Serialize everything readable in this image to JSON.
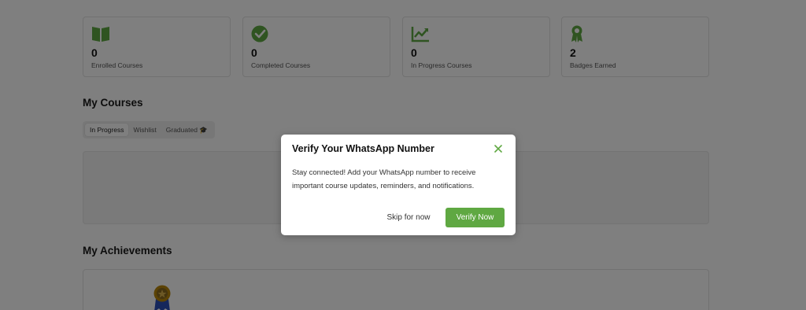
{
  "stats": [
    {
      "value": "0",
      "label": "Enrolled Courses",
      "icon": "book-open-icon"
    },
    {
      "value": "0",
      "label": "Completed Courses",
      "icon": "check-circle-icon"
    },
    {
      "value": "0",
      "label": "In Progress Courses",
      "icon": "chart-line-icon"
    },
    {
      "value": "2",
      "label": "Badges Earned",
      "icon": "award-ribbon-icon"
    }
  ],
  "courses": {
    "title": "My Courses",
    "tabs": [
      {
        "label": "In Progress",
        "active": true
      },
      {
        "label": "Wishlist",
        "active": false
      },
      {
        "label": "Graduated 🎓",
        "active": false
      }
    ]
  },
  "achievements": {
    "title": "My Achievements"
  },
  "modal": {
    "title": "Verify Your WhatsApp Number",
    "body": "Stay connected! Add your WhatsApp number to receive important course updates, reminders, and notifications.",
    "skip_label": "Skip for now",
    "verify_label": "Verify Now",
    "close_icon": "close-icon"
  },
  "colors": {
    "accent": "#5fa842",
    "overlay": "rgba(0,0,0,0.5)"
  }
}
